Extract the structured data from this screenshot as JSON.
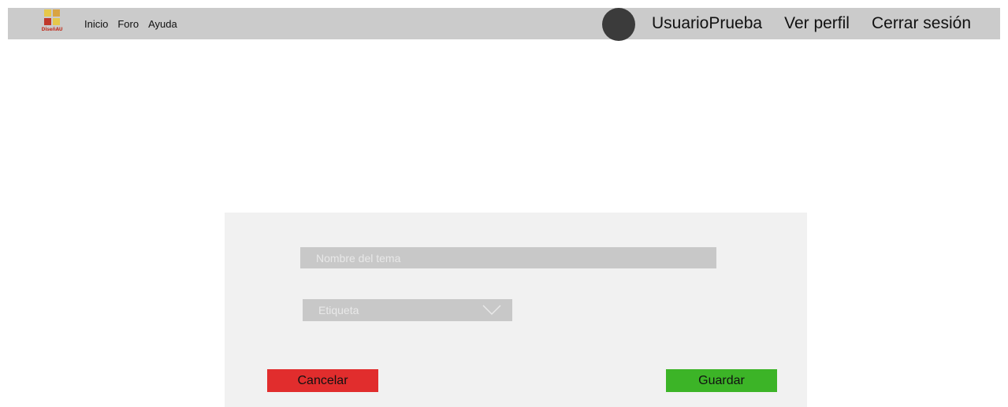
{
  "header": {
    "logo_text": "DiseñAU",
    "logo_colors": [
      "#e6c84a",
      "#d9a441",
      "#c0392b",
      "#e6c84a"
    ],
    "nav": [
      {
        "label": "Inicio"
      },
      {
        "label": "Foro"
      },
      {
        "label": "Ayuda"
      }
    ],
    "username": "UsuarioPrueba",
    "view_profile": "Ver perfil",
    "logout": "Cerrar sesión"
  },
  "form": {
    "topic_placeholder": "Nombre del tema",
    "topic_value": "",
    "tag_selected": "Etiqueta",
    "cancel_label": "Cancelar",
    "save_label": "Guardar"
  },
  "colors": {
    "topbar": "#cbcbcb",
    "panel": "#f1f1f1",
    "field": "#c8c8c8",
    "cancel": "#e12d2d",
    "save": "#3cb427"
  }
}
